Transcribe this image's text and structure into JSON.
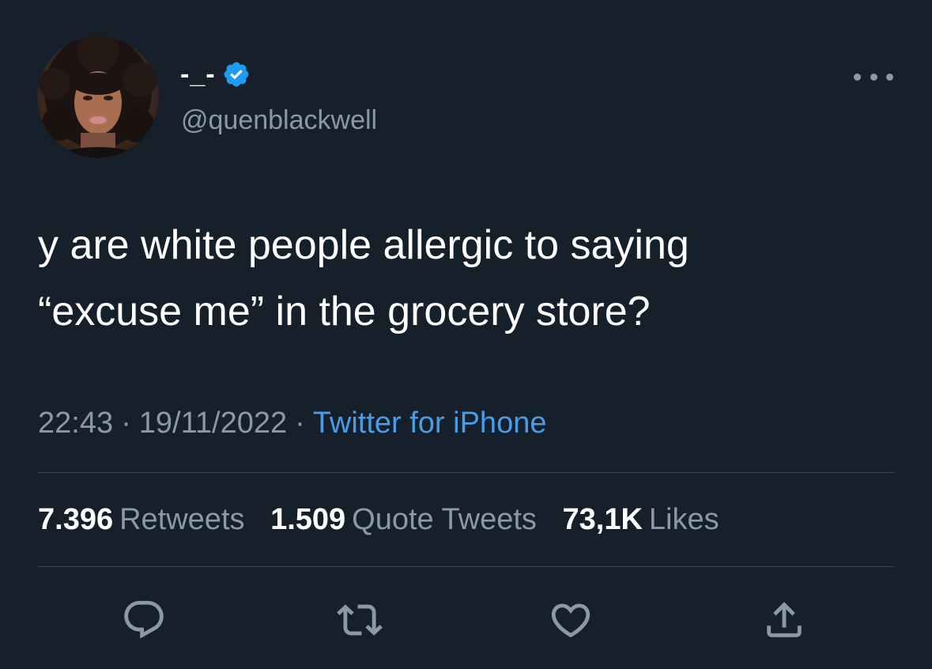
{
  "author": {
    "display_name": "-_-",
    "handle": "@quenblackwell",
    "verified": true,
    "verified_color": "#1d9bf0"
  },
  "tweet": {
    "text": "y are white people allergic to saying\n“excuse me” in the grocery store?"
  },
  "meta": {
    "time": "22:43",
    "date": "19/11/2022",
    "separator": "·",
    "source": "Twitter for iPhone"
  },
  "stats": {
    "retweets": {
      "count": "7.396",
      "label": "Retweets"
    },
    "quotes": {
      "count": "1.509",
      "label": "Quote Tweets"
    },
    "likes": {
      "count": "73,1K",
      "label": "Likes"
    }
  },
  "icons": {
    "reply": "reply-icon",
    "retweet": "retweet-icon",
    "like": "heart-icon",
    "share": "share-icon",
    "more": "more-options-icon"
  },
  "colors": {
    "background": "#15202b",
    "primary_text": "#ffffff",
    "secondary_text": "#8b98a5",
    "link": "#4a9be8",
    "divider": "#38444d"
  }
}
